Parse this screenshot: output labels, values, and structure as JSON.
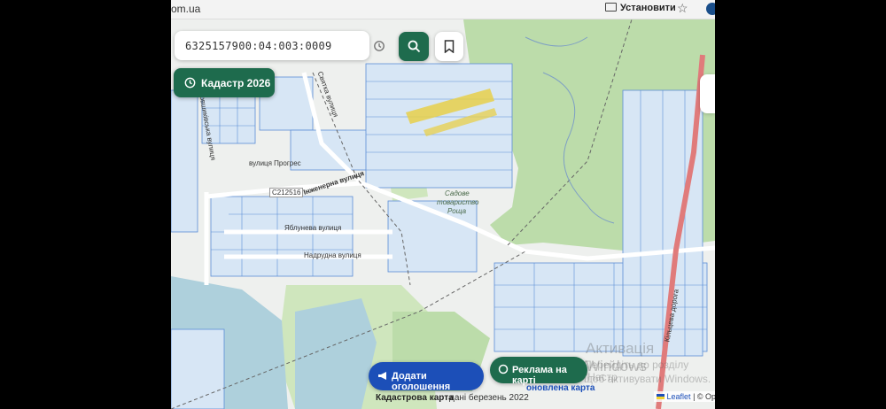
{
  "browser": {
    "url_text": "om.ua",
    "install_label": "Установити"
  },
  "search": {
    "value": "6325157900:04:003:0009"
  },
  "kadastr_button": {
    "label": "Кадастр 2026"
  },
  "map_labels": {
    "svyata_street": "Святка вулиця",
    "kovshyka_street": "Ковшиківська вулиця",
    "progress_street": "вулиця Прогрес",
    "inzhenerna_street": "Інженерна вулиця",
    "road_code": "С212516",
    "garden_partnership_1": "Садове",
    "garden_partnership_2": "товариство",
    "garden_partnership_3": "Роща",
    "yablunova_street": "Яблунева вулиця",
    "nadrudna_street": "Надрудна вулиця",
    "kiltseva_road": "Кільцева дорога"
  },
  "actions": {
    "add_listing": "Додати оголошення",
    "ads_on_map": "Реклама на карті"
  },
  "footer": {
    "map_name": "Кадастрова карта",
    "data_date": "дані березень 2022",
    "updated_map": "оновлена карта"
  },
  "attribution": {
    "leaflet": "Leaflet",
    "osm": "| © Ope"
  },
  "watermark": {
    "line1": "Активація Windows",
    "line2": "Перейдіть до розділу \"Настр",
    "line3": "щоб активувати Windows."
  },
  "colors": {
    "green_button": "#1e6b4d",
    "blue_button": "#1c4fb8",
    "forest": "#bcdcaa",
    "parcel_line": "#5b8ed6"
  }
}
